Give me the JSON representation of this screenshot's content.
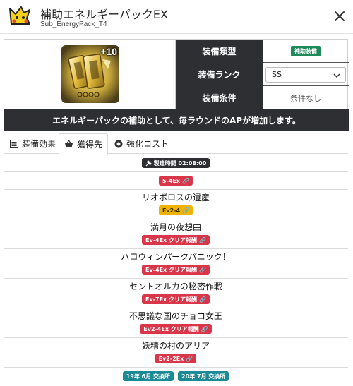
{
  "header": {
    "title": "補助エネルギーパックEX",
    "subtitle": "Sub_EnergyPack_T4"
  },
  "item": {
    "level": "+10",
    "rows": [
      {
        "label": "装備類型",
        "value": "補助装備"
      },
      {
        "label": "装備ランク",
        "value": "SS"
      },
      {
        "label": "装備条件",
        "value": "条件なし"
      }
    ],
    "description": "エネルギーパックの補助として、毎ラウンドのAPが増加します。"
  },
  "tabs": [
    {
      "label": "装備効果",
      "icon": "list-icon"
    },
    {
      "label": "獲得先",
      "icon": "basket-icon",
      "active": true
    },
    {
      "label": "強化コスト",
      "icon": "gear-icon"
    }
  ],
  "sources": {
    "craft_time": "製造時間 02:08:00",
    "entries": [
      {
        "pill": "5-4Ex"
      },
      {
        "name": "リオボロスの遺産",
        "pill": "Ev2-4"
      },
      {
        "name": "満月の夜想曲",
        "pill": "Ev-4Ex クリア報酬"
      },
      {
        "name": "ハロウィンパークパニック！",
        "pill": "Ev-4Ex クリア報酬"
      },
      {
        "name": "セントオルカの秘密作戦",
        "pill": "Ev-7Ex クリア報酬"
      },
      {
        "name": "不思議な国のチョコ女王",
        "pill": "Ev2-4Ex クリア報酬"
      },
      {
        "name": "妖精の村のアリア",
        "pill": "Ev2-2Ex"
      }
    ],
    "exchange": [
      "19年 6月 交換所",
      "20年 7月 交換所"
    ]
  },
  "colors": {
    "dark": "#2d2f33",
    "red": "#d9364a",
    "yellow": "#f0b400",
    "green": "#1e8a5a",
    "teal": "#1c8a94"
  }
}
